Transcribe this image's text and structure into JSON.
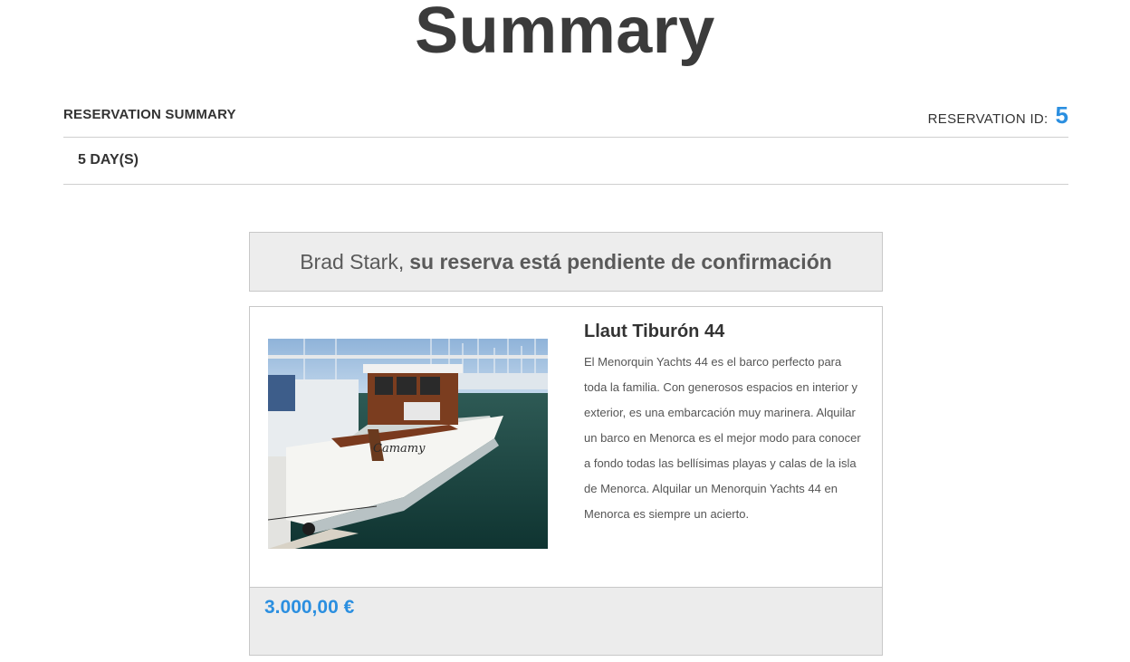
{
  "page": {
    "title": "Summary"
  },
  "reservation": {
    "summary_label": "RESERVATION SUMMARY",
    "id_label": "RESERVATION ID:",
    "id_value": "5",
    "days_label": "5 DAY(S)"
  },
  "status": {
    "customer_name": "Brad Stark,",
    "message": "su reserva está pendiente de confirmación"
  },
  "boat": {
    "name": "Llaut Tiburón 44",
    "description": "El Menorquin Yachts 44 es el barco perfecto para toda la familia. Con generosos espacios en interior y exterior, es una embarcación muy marinera. Alquilar un barco en Menorca es el mejor modo para conocer a fondo todas las bellísimas playas y calas de la isla de Menorca. Alquilar un Menorquin Yachts 44 en Menorca es siempre un acierto.",
    "hull_name": "Camamy",
    "price": "3.000,00 €"
  },
  "colors": {
    "accent": "#2b8fe0",
    "status_bg": "#ededed",
    "title": "#3b3b3b"
  }
}
